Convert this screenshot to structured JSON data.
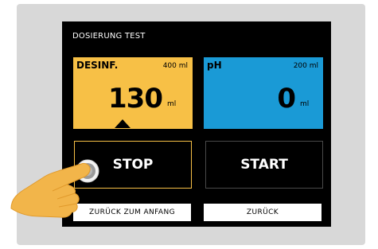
{
  "screen": {
    "title": "DOSIERUNG TEST"
  },
  "panels": [
    {
      "label": "DESINF.",
      "capacity": "400 ml",
      "value": "130",
      "unit": "ml",
      "color": "#f7c046"
    },
    {
      "label": "pH",
      "capacity": "200 ml",
      "value": "0",
      "unit": "ml",
      "color": "#1a9ad6"
    }
  ],
  "actions": {
    "stop_label": "STOP",
    "start_label": "START"
  },
  "nav": {
    "back_to_start_label": "ZURÜCK ZUM ANFANG",
    "back_label": "ZURÜCK"
  },
  "icons": {
    "pointer": "tap-hand-icon"
  },
  "colors": {
    "device_bg": "#d8d8d8",
    "screen_bg": "#000000",
    "desinf_accent": "#f7c046",
    "ph_accent": "#1a9ad6"
  }
}
